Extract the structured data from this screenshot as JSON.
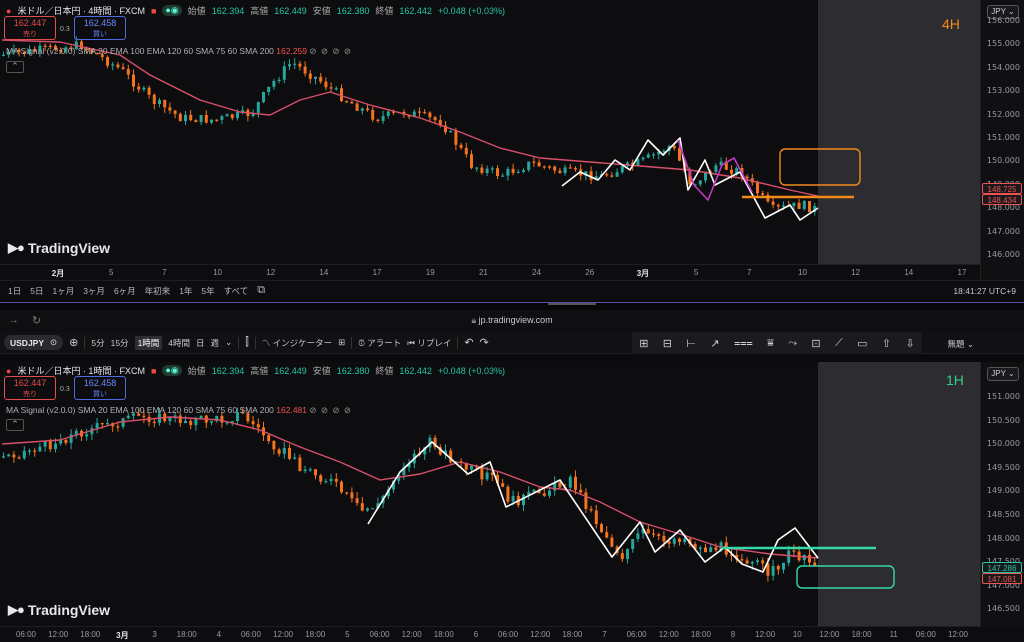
{
  "top": {
    "title": "米ドル／日本円 · 4時間 · FXCM",
    "ohlc": [
      {
        "k": "始値",
        "v": "162.394"
      },
      {
        "k": "高値",
        "v": "162.449"
      },
      {
        "k": "安値",
        "v": "162.380"
      },
      {
        "k": "終値",
        "v": "162.442"
      },
      {
        "k": "",
        "v": "+0.048 (+0.03%)"
      }
    ],
    "sell": {
      "price": "162.447",
      "label": "売り"
    },
    "buy": {
      "price": "162.458",
      "label": "買い"
    },
    "spread": "0.3",
    "ma": "MA Signal (v2.0.0) SMA 20 EMA 100 EMA 120 60 SMA 75 60 SMA 200",
    "ma_val": "162.259",
    "signals": "⊘ ⊘ ⊘ ⊘",
    "collapse": "⌃",
    "timeframe": "4H",
    "timeframe_color": "#f08a1a",
    "currency": "JPY",
    "prices": [
      "156.000",
      "155.000",
      "154.000",
      "153.000",
      "152.000",
      "151.000",
      "150.000",
      "149.000",
      "148.000",
      "147.000",
      "146.000"
    ],
    "tags": [
      {
        "v": "148.725",
        "bg": "#1a1a1e",
        "fg": "#ef5350",
        "border": "#ef5350"
      },
      {
        "v": "148.434",
        "bg": "#1a1a1e",
        "fg": "#ef5350",
        "border": "#ef5350"
      }
    ],
    "xticks": [
      {
        "t": "2月",
        "b": true
      },
      {
        "t": "5"
      },
      {
        "t": "7"
      },
      {
        "t": "10"
      },
      {
        "t": "12"
      },
      {
        "t": "14"
      },
      {
        "t": "17"
      },
      {
        "t": "19"
      },
      {
        "t": "21"
      },
      {
        "t": "24"
      },
      {
        "t": "26"
      },
      {
        "t": "3月",
        "b": true
      },
      {
        "t": "5"
      },
      {
        "t": "7"
      },
      {
        "t": "10"
      },
      {
        "t": "12"
      },
      {
        "t": "14"
      },
      {
        "t": "17"
      }
    ],
    "ranges": [
      "1日",
      "5日",
      "1ヶ月",
      "3ヶ月",
      "6ヶ月",
      "年初来",
      "1年",
      "5年",
      "すべて"
    ],
    "clock": "18:41:27 UTC+9",
    "logo": "TradingView"
  },
  "browser": {
    "url": "jp.tradingview.com",
    "back": "→",
    "reload": "↻"
  },
  "toolbar": {
    "symbol": "USDJPY",
    "add": "⊕",
    "intervals": [
      "5分",
      "15分",
      "1時間",
      "4時間",
      "日",
      "週"
    ],
    "active_interval": "1時間",
    "indicators": "インジケーター",
    "alert": "アラート",
    "replay": "リプレイ",
    "undo": "↶",
    "redo": "↷",
    "preset": "無題",
    "draw_icons": [
      "⊞",
      "⊟",
      "⊢",
      "↗",
      "⩶",
      "⩸",
      "⤳",
      "⊡",
      "⟋",
      "▭",
      "⇧",
      "⇩"
    ]
  },
  "bottom": {
    "title": "米ドル／日本円 · 1時間 · FXCM",
    "ohlc": [
      {
        "k": "始値",
        "v": "162.394"
      },
      {
        "k": "高値",
        "v": "162.449"
      },
      {
        "k": "安値",
        "v": "162.380"
      },
      {
        "k": "終値",
        "v": "162.442"
      },
      {
        "k": "",
        "v": "+0.048 (+0.03%)"
      }
    ],
    "sell": {
      "price": "162.447",
      "label": "売り"
    },
    "buy": {
      "price": "162.458",
      "label": "買い"
    },
    "spread": "0.3",
    "ma": "MA Signal (v2.0.0) SMA 20 EMA 100 EMA 120 60 SMA 75 60 SMA 200",
    "ma_val": "162.481",
    "signals": "⊘ ⊘ ⊘ ⊘",
    "collapse": "⌃",
    "timeframe": "1H",
    "timeframe_color": "#34d08a",
    "currency": "JPY",
    "prices": [
      "151.000",
      "150.500",
      "150.000",
      "149.500",
      "149.000",
      "148.500",
      "148.000",
      "147.500",
      "147.000",
      "146.500"
    ],
    "tags": [
      {
        "v": "147.286",
        "bg": "#1a1a1e",
        "fg": "#26c6a6",
        "border": "#26c6a6"
      },
      {
        "v": "147.081",
        "bg": "#1a1a1e",
        "fg": "#ef5350",
        "border": "#ef5350"
      }
    ],
    "xticks": [
      {
        "t": "06:00"
      },
      {
        "t": "12:00"
      },
      {
        "t": "18:00"
      },
      {
        "t": "3月",
        "b": true
      },
      {
        "t": "3"
      },
      {
        "t": "18:00"
      },
      {
        "t": "4"
      },
      {
        "t": "06:00"
      },
      {
        "t": "12:00"
      },
      {
        "t": "18:00"
      },
      {
        "t": "5"
      },
      {
        "t": "06:00"
      },
      {
        "t": "12:00"
      },
      {
        "t": "18:00"
      },
      {
        "t": "6"
      },
      {
        "t": "06:00"
      },
      {
        "t": "12:00"
      },
      {
        "t": "18:00"
      },
      {
        "t": "7"
      },
      {
        "t": "06:00"
      },
      {
        "t": "12:00"
      },
      {
        "t": "18:00"
      },
      {
        "t": "8"
      },
      {
        "t": "12:00"
      },
      {
        "t": "10"
      },
      {
        "t": "12:00"
      },
      {
        "t": "18:00"
      },
      {
        "t": "11"
      },
      {
        "t": "06:00"
      },
      {
        "t": "12:00"
      }
    ],
    "logo": "TradingView"
  },
  "colors": {
    "up": "#26a69a",
    "down": "#f5731f",
    "ma": "#d9506a",
    "zig": "#ffffff",
    "zig_pink": "#c238c8",
    "orange": "#f08a1a",
    "teal": "#34d9a8",
    "shade": "#2d2d31"
  }
}
